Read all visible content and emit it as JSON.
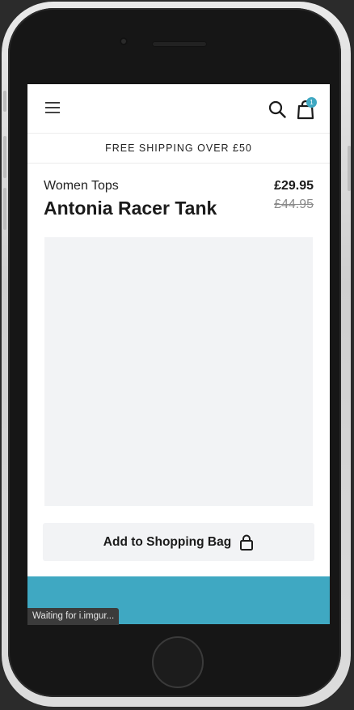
{
  "header": {
    "cart_count": "1"
  },
  "banner": {
    "shipping_text": "FREE SHIPPING OVER £50"
  },
  "product": {
    "category": "Women Tops",
    "title": "Antonia Racer Tank",
    "price_current": "£29.95",
    "price_old": "£44.95"
  },
  "actions": {
    "add_to_bag_label": "Add to Shopping Bag"
  },
  "status": {
    "loading_text": "Waiting for i.imgur..."
  },
  "colors": {
    "accent": "#3fa8c2",
    "image_placeholder": "#f2f3f5"
  },
  "icons": {
    "menu": "hamburger-menu-icon",
    "search": "search-icon",
    "bag": "shopping-bag-icon",
    "lock": "padlock-icon"
  }
}
